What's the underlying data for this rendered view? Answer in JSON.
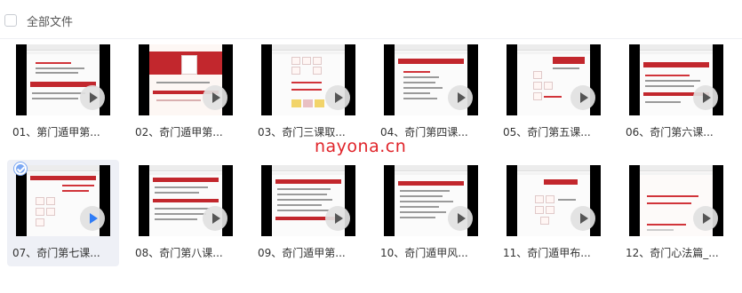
{
  "header": {
    "title": "全部文件"
  },
  "watermark": "nayona.cn",
  "videos": [
    {
      "title": "01、第门遁甲第..."
    },
    {
      "title": "02、奇门遁甲第..."
    },
    {
      "title": "03、奇门三课取..."
    },
    {
      "title": "04、奇门第四课..."
    },
    {
      "title": "05、奇门第五课..."
    },
    {
      "title": "06、奇门第六课..."
    },
    {
      "title": "07、奇门第七课..."
    },
    {
      "title": "08、奇门第八课..."
    },
    {
      "title": "09、奇门遁甲第..."
    },
    {
      "title": "10、奇门遁甲风..."
    },
    {
      "title": "11、奇门遁甲布..."
    },
    {
      "title": "12、奇门心法篇_..."
    }
  ],
  "selected_index": 6,
  "colors": {
    "accent": "#2f7cf6",
    "watermark": "#e0242a",
    "slide_red": "#c2272d"
  }
}
